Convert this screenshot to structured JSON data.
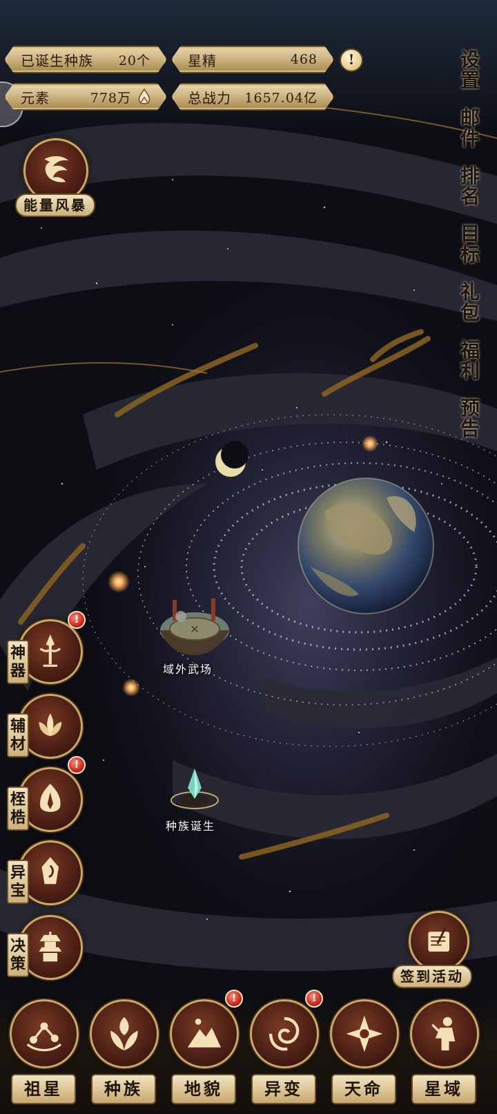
{
  "stats": {
    "races_born_label": "已诞生种族",
    "races_born_value": "20个",
    "star_essence_label": "星精",
    "star_essence_value": "468",
    "element_label": "元素",
    "element_value": "778万",
    "power_label": "总战力",
    "power_value": "1657.04亿",
    "alert_symbol": "!"
  },
  "right_menu": [
    {
      "top": "设",
      "bottom": "置"
    },
    {
      "top": "邮",
      "bottom": "件"
    },
    {
      "top": "排",
      "bottom": "名"
    },
    {
      "top": "目",
      "bottom": "标"
    },
    {
      "top": "礼",
      "bottom": "包"
    },
    {
      "top": "福",
      "bottom": "利"
    },
    {
      "top": "预",
      "bottom": "告"
    }
  ],
  "energy_storm_label": "能量风暴",
  "map_labels": {
    "arena": "域外武场",
    "race_birth": "种族诞生"
  },
  "left_menu": [
    {
      "line1": "神",
      "line2": "器",
      "badge": "!"
    },
    {
      "line1": "辅",
      "line2": "材",
      "badge": ""
    },
    {
      "line1": "桎",
      "line2": "梏",
      "badge": "!"
    },
    {
      "line1": "异",
      "line2": "宝",
      "badge": ""
    },
    {
      "line1": "决",
      "line2": "策",
      "badge": ""
    }
  ],
  "checkin_label": "签到活动",
  "bottom_nav": [
    {
      "label": "祖星",
      "badge": ""
    },
    {
      "label": "种族",
      "badge": ""
    },
    {
      "label": "地貌",
      "badge": "!"
    },
    {
      "label": "异变",
      "badge": "!"
    },
    {
      "label": "天命",
      "badge": ""
    },
    {
      "label": "星域",
      "badge": ""
    }
  ],
  "colors": {
    "gold": "#c9a868",
    "parchment": "#e9d6ad",
    "badge_red": "#c2190f",
    "space": "#0d0d14"
  }
}
